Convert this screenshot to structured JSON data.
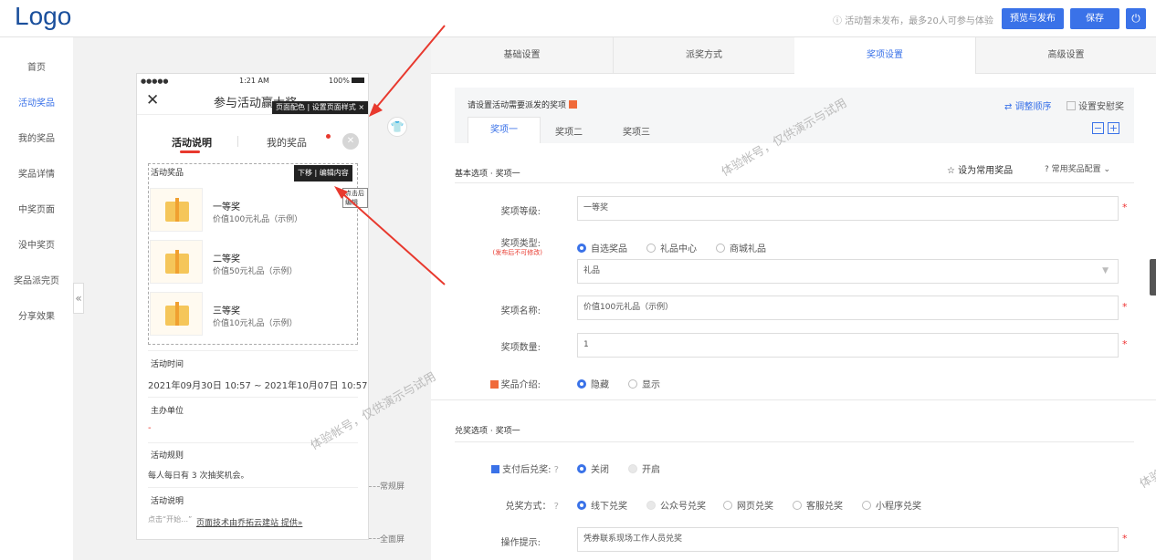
{
  "header": {
    "logo": "Logo",
    "notice": "活动暂未发布，最多20人可参与体验",
    "preview_publish": "预览与发布",
    "save": "保存"
  },
  "sidebar": {
    "items": [
      "首页",
      "活动奖品",
      "我的奖品",
      "奖品详情",
      "中奖页面",
      "没中奖页",
      "奖品派完页",
      "分享效果"
    ],
    "active_index": 1
  },
  "phone": {
    "status": {
      "signal": "●●●●●",
      "time": "1:21 AM",
      "battery": "100%"
    },
    "title": "参与活动赢大奖",
    "tip_top": "页面配色 | 设置页面样式 ×",
    "tabs": [
      "活动说明",
      "我的奖品"
    ],
    "prize_section": "活动奖品",
    "tip_mid": "下移 | 编辑内容",
    "tip_click": "点击后编辑",
    "prizes": [
      {
        "name": "一等奖",
        "desc": "价值100元礼品（示例）"
      },
      {
        "name": "二等奖",
        "desc": "价值50元礼品（示例）"
      },
      {
        "name": "三等奖",
        "desc": "价值10元礼品（示例）"
      }
    ],
    "time_label": "活动时间",
    "time_value": "2021年09月30日 10:57 ~ 2021年10月07日 10:57",
    "org_label": "主办单位",
    "org_value": "-",
    "rule_label": "活动规则",
    "rule_value": "每人每日有 3 次抽奖机会。",
    "desc_label": "活动说明",
    "desc_value": "点击“开始…”",
    "footer": "页面技术由乔拓云建站 提供»"
  },
  "side_labels": {
    "normal": "常规屏",
    "full": "全面屏"
  },
  "tabs_top": [
    "基础设置",
    "派奖方式",
    "奖项设置",
    "高级设置"
  ],
  "tabs_top_active": 2,
  "prize_panel": {
    "title": "请设置活动需要派发的奖项",
    "adjust": "调整顺序",
    "comfort": "设置安慰奖",
    "sub_tabs": [
      "奖项一",
      "奖项二",
      "奖项三"
    ],
    "minus": "−",
    "plus": "+"
  },
  "basic": {
    "section": "基本选项 · 奖项一",
    "set_common": "设为常用奖品",
    "common_config": "常用奖品配置",
    "level_label": "奖项等级:",
    "level_value": "一等奖",
    "type_label": "奖项类型:",
    "type_note": "(发布后不可修改)",
    "type_options": [
      "自选奖品",
      "礼品中心",
      "商城礼品"
    ],
    "type_select": "礼品",
    "name_label": "奖项名称:",
    "name_value": "价值100元礼品（示例）",
    "qty_label": "奖项数量:",
    "qty_value": "1",
    "intro_label": "奖品介绍:",
    "intro_options": [
      "隐藏",
      "显示"
    ]
  },
  "redeem": {
    "section": "兑奖选项 · 奖项一",
    "pay_label": "支付后兑奖:",
    "pay_options": [
      "关闭",
      "开启"
    ],
    "method_label": "兑奖方式：",
    "methods": [
      "线下兑奖",
      "公众号兑奖",
      "网页兑奖",
      "客服兑奖",
      "小程序兑奖"
    ],
    "tip_label": "操作提示:",
    "tip_value": "凭券联系现场工作人员兑奖"
  },
  "watermark": "体验帐号，仅供演示与试用",
  "colors": {
    "accent": "#3a72e8",
    "arrow": "#e8392e",
    "required": "#e33333"
  }
}
